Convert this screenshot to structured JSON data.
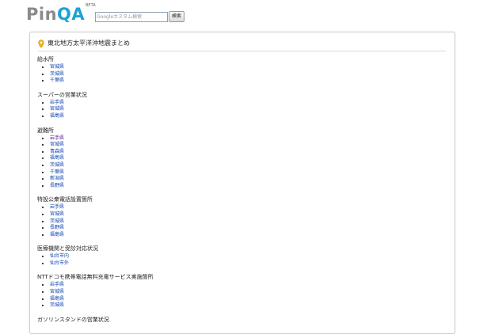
{
  "header": {
    "logo_pin": "Pin",
    "logo_qa": "QA",
    "beta": "BETA",
    "search_placeholder": "Googleカスタム検索",
    "search_button": "検索"
  },
  "panel": {
    "title": "東北地方太平洋沖地震まとめ",
    "sections": [
      {
        "heading": "給水所",
        "items": [
          "宮城県",
          "茨城県",
          "千葉県"
        ]
      },
      {
        "heading": "スーパーの営業状況",
        "items": [
          "岩手県",
          "宮城県",
          "福島県"
        ]
      },
      {
        "heading": "避難所",
        "items": [
          "岩手県",
          "宮城県",
          "青森県",
          "福島県",
          "茨城県",
          "千葉県",
          "新潟県",
          "長野県"
        ]
      },
      {
        "heading": "特設公衆電話設置箇所",
        "items": [
          "岩手県",
          "宮城県",
          "茨城県",
          "長野県",
          "福島県"
        ]
      },
      {
        "heading": "医療機関と受診対応状況",
        "items": [
          "仙台市内",
          "仙台市外"
        ]
      },
      {
        "heading": "NTTドコモ携帯電話無料充電サービス実施箇所",
        "items": [
          "岩手県",
          "宮城県",
          "福島県",
          "茨城県"
        ]
      },
      {
        "heading": "ガソリンスタンドの営業状況",
        "items": []
      }
    ]
  },
  "colors": {
    "logo_qa": "#1aa3d3",
    "logo_pin": "#8a8a8a",
    "link": "#0b3fb0",
    "visited_link": "#551a8b"
  },
  "icons": {
    "title_icon": "map-pin-icon"
  }
}
